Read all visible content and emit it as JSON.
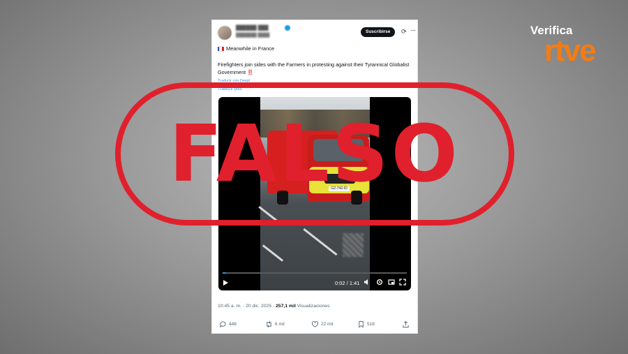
{
  "post": {
    "subscribe_label": "Suscribirse",
    "line1": "Meanwhile in France",
    "body_text": "Firefighters join sides with the Farmers in protesting against their Tyrannical Globalist Government",
    "body_emoji": "‼️",
    "translate_deepl": "Traducir con Deepl",
    "translate_post": "Traducir post",
    "time": "10:45 a. m.",
    "separator": "·",
    "date": "20 dic. 2025",
    "views_count": "257,1 mil",
    "views_label": "Visualizaciones"
  },
  "video": {
    "time": "0:02 / 1:41",
    "progress": 0.02,
    "plate_text": "GZ-742-ID"
  },
  "actions": {
    "replies": "448",
    "reposts": "6 mil",
    "likes": "22 mil",
    "bookmarks": "518"
  },
  "overlay": {
    "stamp_text": "FALSO"
  },
  "brand": {
    "top": "Verifica",
    "bottom": "rtve"
  },
  "colors": {
    "stamp": "#e0202c",
    "brand_orange": "#f47c13",
    "link": "#1d9bf0"
  },
  "icons": [
    "grok-icon",
    "more-icon",
    "play-icon",
    "volume-icon",
    "settings-icon",
    "fullscreen-icon",
    "reply-icon",
    "repost-icon",
    "like-icon",
    "bookmark-icon",
    "share-icon"
  ]
}
